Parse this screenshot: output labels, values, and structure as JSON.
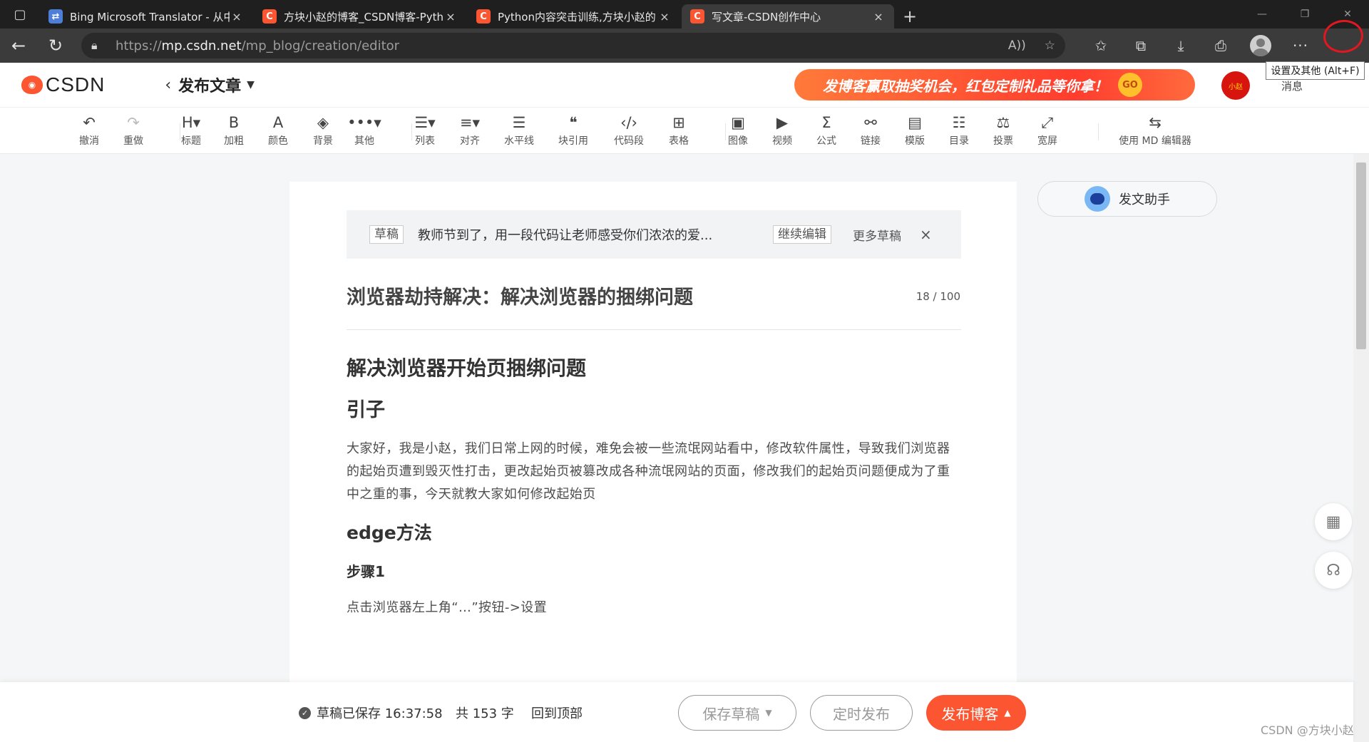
{
  "browser": {
    "tabs": [
      {
        "title": "Bing Microsoft Translator - 从中文",
        "favicon": "bing",
        "close": "×"
      },
      {
        "title": "方块小赵的博客_CSDN博客-Pytho",
        "favicon": "C",
        "close": "×"
      },
      {
        "title": "Python内容突击训练,方块小赵的",
        "favicon": "C",
        "close": "×"
      },
      {
        "title": "写文章-CSDN创作中心",
        "favicon": "C",
        "close": "×"
      }
    ],
    "new_tab": "+",
    "url_prefix": "https://",
    "url_host": "mp.csdn.net",
    "url_path": "/mp_blog/creation/editor",
    "tooltip": "设置及其他 (Alt+F)",
    "more_button": "···",
    "highlight_color": "#e3171f"
  },
  "header": {
    "logo_text": "CSDN",
    "back": "‹",
    "page_title": "发布文章",
    "banner_text": "发博客赢取抽奖机会，红包定制礼品等你拿！",
    "banner_go": "GO",
    "avatar_text": "小赵",
    "messages": "消息"
  },
  "toolbar": {
    "items": [
      {
        "icon": "↶",
        "label": "撤消"
      },
      {
        "icon": "↷",
        "label": "重做"
      },
      {
        "icon": "H▾",
        "label": "标题"
      },
      {
        "icon": "B",
        "label": "加粗"
      },
      {
        "icon": "A",
        "label": "颜色"
      },
      {
        "icon": "◈",
        "label": "背景"
      },
      {
        "icon": "•••▾",
        "label": "其他"
      },
      {
        "icon": "☰▾",
        "label": "列表"
      },
      {
        "icon": "≡▾",
        "label": "对齐"
      },
      {
        "icon": "☰",
        "label": "水平线"
      },
      {
        "icon": "❝",
        "label": "块引用"
      },
      {
        "icon": "‹/›",
        "label": "代码段"
      },
      {
        "icon": "⊞",
        "label": "表格"
      },
      {
        "icon": "▣",
        "label": "图像"
      },
      {
        "icon": "▶",
        "label": "视频"
      },
      {
        "icon": "Σ",
        "label": "公式"
      },
      {
        "icon": "⚯",
        "label": "链接"
      },
      {
        "icon": "▤",
        "label": "模版"
      },
      {
        "icon": "☷",
        "label": "目录"
      },
      {
        "icon": "⚖",
        "label": "投票"
      },
      {
        "icon": "⤢",
        "label": "宽屏"
      },
      {
        "icon": "⇆",
        "label": "使用 MD 编辑器"
      }
    ]
  },
  "draft": {
    "tag": "草稿",
    "title": "教师节到了，用一段代码让老师感受你们浓浓的爱...",
    "continue": "继续编辑",
    "more": "更多草稿",
    "close": "×"
  },
  "article": {
    "title": "浏览器劫持解决：解决浏览器的捆绑问题",
    "title_count": "18 / 100",
    "h1": "解决浏览器开始页捆绑问题",
    "h2": "引子",
    "intro": "大家好，我是小赵，我们日常上网的时候，难免会被一些流氓网站看中，修改软件属性，导致我们浏览器的起始页遭到毁灭性打击，更改起始页被篡改成各种流氓网站的页面，修改我们的起始页问题便成为了重中之重的事，今天就教大家如何修改起始页",
    "h3": "edge方法",
    "h4": "步骤1",
    "step1": "点击浏览器左上角“…”按钮->设置"
  },
  "assistant": {
    "label": "发文助手"
  },
  "footer": {
    "saved": "草稿已保存 16:37:58",
    "words": "共 153 字",
    "to_top": "回到顶部",
    "save_draft": "保存草稿",
    "scheduled": "定时发布",
    "publish": "发布博客",
    "watermark": "CSDN @方块小赵"
  },
  "colors": {
    "accent": "#fc5531",
    "chrome_dark": "#1f1f1f",
    "chrome_bar": "#3b3b3b"
  }
}
